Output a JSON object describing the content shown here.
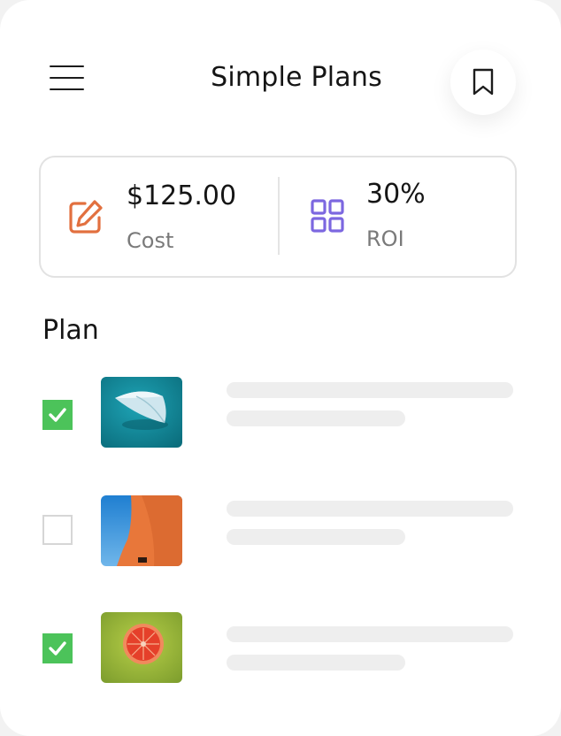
{
  "header": {
    "title": "Simple Plans",
    "menu_icon": "hamburger-menu-icon",
    "bookmark_icon": "bookmark-icon"
  },
  "stats": {
    "cost": {
      "value": "$125.00",
      "label": "Cost",
      "icon": "edit-icon",
      "color": "#e2703f"
    },
    "roi": {
      "value": "30%",
      "label": "ROI",
      "icon": "grid-icon",
      "color": "#7c67e0"
    }
  },
  "plan": {
    "title": "Plan",
    "items": [
      {
        "checked": true,
        "thumbnail": "teal-boat-photo"
      },
      {
        "checked": false,
        "thumbnail": "orange-building-sky-photo"
      },
      {
        "checked": true,
        "thumbnail": "grapefruit-on-green-photo"
      }
    ]
  },
  "colors": {
    "check_green": "#4cc35a",
    "border_gray": "#e2e2e2",
    "skeleton_gray": "#eeeeee"
  }
}
